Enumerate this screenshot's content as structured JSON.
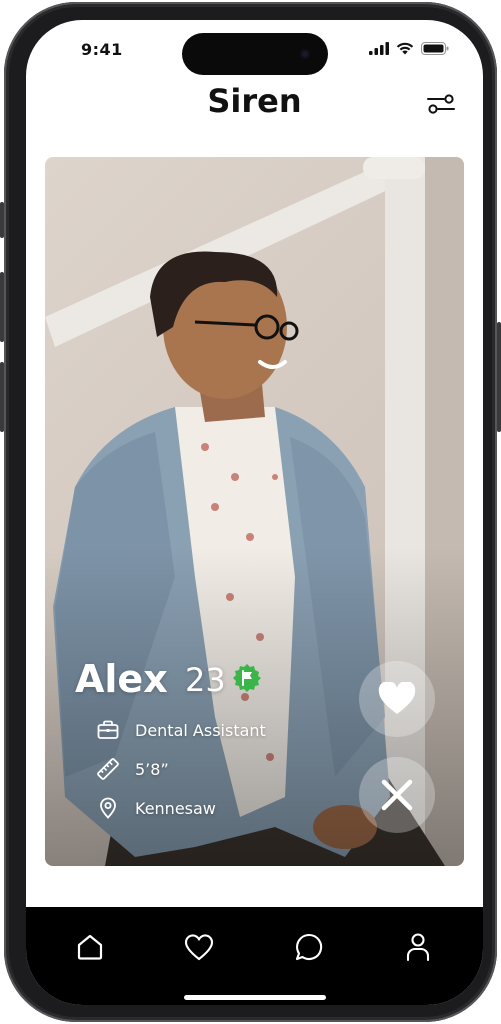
{
  "status_bar": {
    "time": "9:41"
  },
  "header": {
    "title": "Siren",
    "filter_icon": "sliders-icon"
  },
  "profile": {
    "name": "Alex",
    "age": "23",
    "verified_badge_icon": "verified-flag-icon",
    "details": [
      {
        "icon": "briefcase-icon",
        "text": "Dental Assistant"
      },
      {
        "icon": "ruler-icon",
        "text": "5’8”"
      },
      {
        "icon": "location-pin-icon",
        "text": "Kennesaw"
      }
    ]
  },
  "actions": {
    "like_icon": "heart-icon",
    "dislike_icon": "close-icon"
  },
  "nav": [
    {
      "name": "home",
      "icon": "home-icon",
      "active": true
    },
    {
      "name": "likes",
      "icon": "heart-outline-icon",
      "active": false
    },
    {
      "name": "messages",
      "icon": "chat-bubble-icon",
      "active": false
    },
    {
      "name": "profile",
      "icon": "person-icon",
      "active": false
    }
  ],
  "colors": {
    "verified": "#3bb54a",
    "nav_background": "#000000",
    "text_dark": "#111111"
  }
}
